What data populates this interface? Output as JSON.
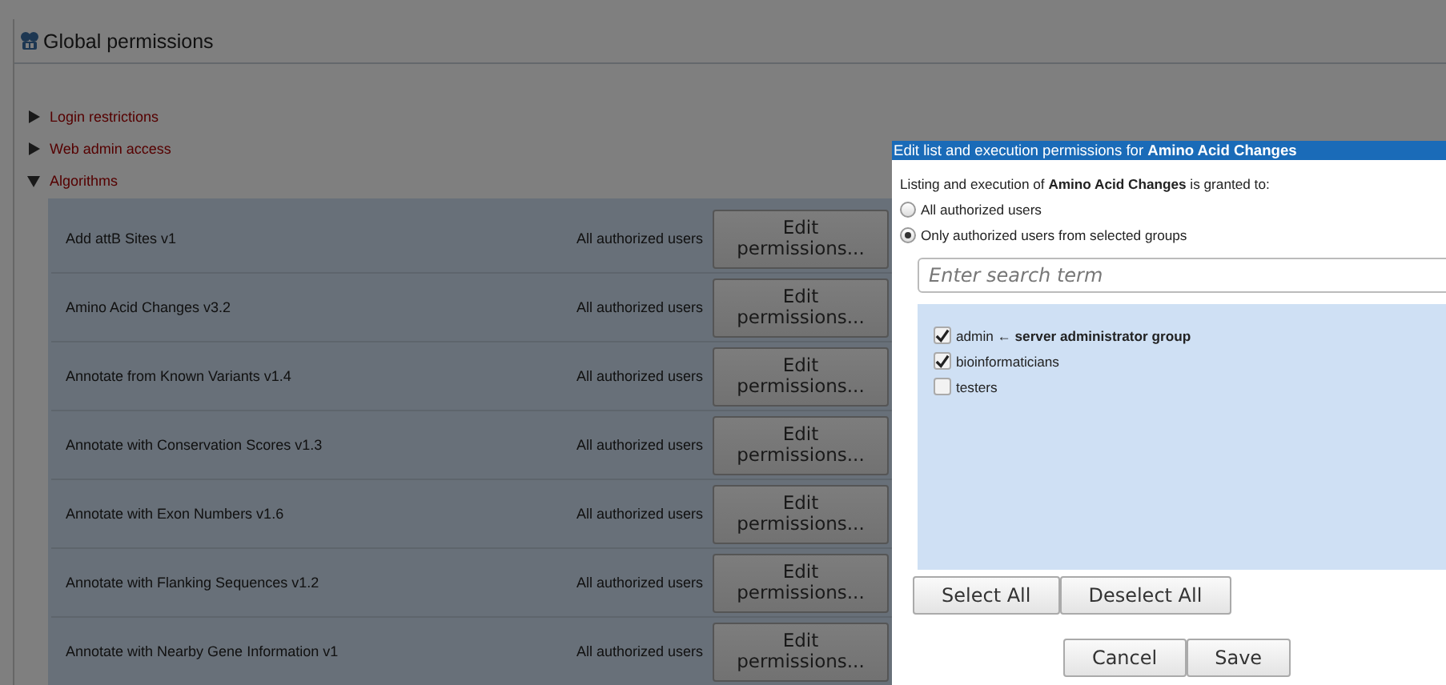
{
  "page": {
    "title": "Global permissions"
  },
  "sections": [
    {
      "label": "Login restrictions",
      "expanded": false
    },
    {
      "label": "Web admin access",
      "expanded": false
    },
    {
      "label": "Algorithms",
      "expanded": true
    }
  ],
  "algorithms": [
    {
      "name": "Add attB Sites v1",
      "access": "All authorized users",
      "button": "Edit permissions..."
    },
    {
      "name": "Amino Acid Changes v3.2",
      "access": "All authorized users",
      "button": "Edit permissions..."
    },
    {
      "name": "Annotate from Known Variants v1.4",
      "access": "All authorized users",
      "button": "Edit permissions..."
    },
    {
      "name": "Annotate with Conservation Scores v1.3",
      "access": "All authorized users",
      "button": "Edit permissions..."
    },
    {
      "name": "Annotate with Exon Numbers v1.6",
      "access": "All authorized users",
      "button": "Edit permissions..."
    },
    {
      "name": "Annotate with Flanking Sequences v1.2",
      "access": "All authorized users",
      "button": "Edit permissions..."
    },
    {
      "name": "Annotate with Nearby Gene Information v1",
      "access": "All authorized users",
      "button": "Edit permissions..."
    }
  ],
  "dialog": {
    "title": "Edit list and execution permissions for **Amino Acid Changes**",
    "intro": "Listing and execution of **Amino Acid Changes** is granted to:",
    "options": [
      {
        "label": "All authorized users",
        "selected": false
      },
      {
        "label": "Only authorized users from selected groups",
        "selected": true
      }
    ],
    "search": {
      "placeholder": "Enter search term"
    },
    "groups": [
      {
        "label": "admin ← **server administrator group**",
        "checked": true
      },
      {
        "label": "bioinformaticians",
        "checked": true
      },
      {
        "label": "testers",
        "checked": false
      }
    ],
    "list_buttons": [
      "Select All",
      "Deselect All"
    ],
    "buttons": [
      "Cancel",
      "Save"
    ]
  }
}
